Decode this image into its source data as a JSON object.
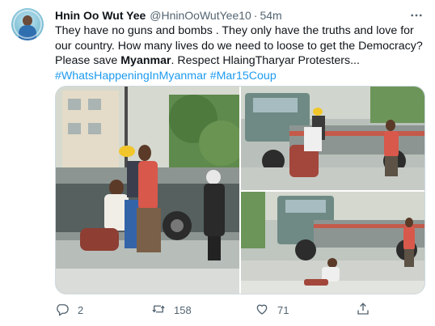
{
  "tweet": {
    "author": {
      "display_name": "Hnin Oo Wut Yee",
      "handle": "@HninOoWutYee10",
      "separator": "·",
      "time": "54m"
    },
    "text": {
      "part1": "They have no guns and bombs . They only have the truths and love for our country. How many lives do we need to loose to get the Democracy? Please save ",
      "bold": "Myanmar",
      "part2": ". Respect HlaingTharyar Protesters...",
      "hashtags": [
        "#WhatsHappeningInMyanmar",
        "#Mar15Coup"
      ]
    },
    "media": {
      "photos": [
        {
          "label": "protesters-carrying-injured-woman"
        },
        {
          "label": "protesters-near-truck"
        },
        {
          "label": "man-fallen-on-street-near-truck"
        }
      ]
    },
    "actions": {
      "reply_count": "2",
      "retweet_count": "158",
      "like_count": "71",
      "icons": [
        "reply-icon",
        "retweet-icon",
        "like-icon",
        "share-icon"
      ]
    },
    "colors": {
      "link": "#1d9bf0",
      "secondary_text": "#536471",
      "primary_text": "#0f1419"
    }
  }
}
